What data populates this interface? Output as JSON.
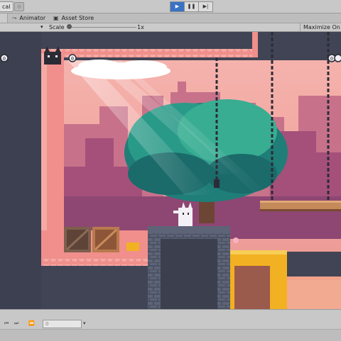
{
  "toolbar": {
    "layout_label": "cal",
    "buttons": [
      {
        "name": "play-button",
        "icon": "play-icon",
        "glyph": "▶",
        "active": true
      },
      {
        "name": "pause-button",
        "icon": "pause-icon",
        "glyph": "❚❚",
        "active": false
      },
      {
        "name": "step-button",
        "icon": "step-icon",
        "glyph": "▶|",
        "active": false
      }
    ]
  },
  "tabs": [
    {
      "label": "Animator",
      "icon": "animator-icon",
      "glyph": "⤳"
    },
    {
      "label": "Asset Store",
      "icon": "store-icon",
      "glyph": "▣"
    }
  ],
  "game_view": {
    "scale_label": "Scale",
    "scale_value": "1x",
    "maximize_label": "Maximize On P"
  },
  "hud": {
    "left_counter": "0",
    "player_counter": "0",
    "right_counter": "0"
  },
  "bottom": {
    "field_value": "0",
    "icons": [
      "rewind-icon",
      "fast-forward-icon"
    ]
  },
  "colors": {
    "play_active": "#3a72c4",
    "wall_dark": "#414454",
    "ground_pink": "#f08f8c",
    "sky_pink": "#f2a49e",
    "tree_teal": "#2a9a88",
    "grass_yellow": "#f2b122"
  }
}
